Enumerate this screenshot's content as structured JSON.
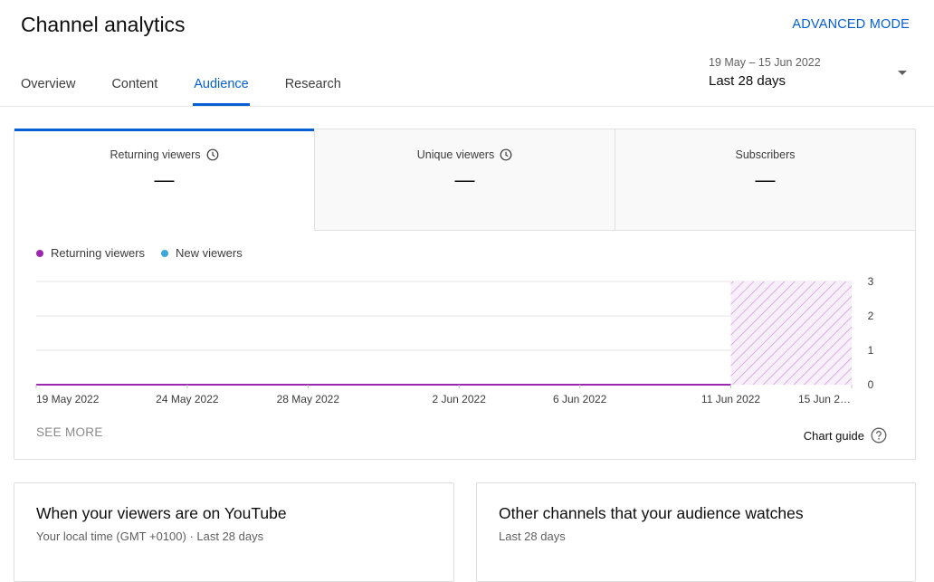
{
  "header": {
    "title": "Channel analytics",
    "advanced_mode": "ADVANCED MODE"
  },
  "tabs": [
    {
      "label": "Overview"
    },
    {
      "label": "Content"
    },
    {
      "label": "Audience",
      "active": true
    },
    {
      "label": "Research"
    }
  ],
  "date_picker": {
    "range": "19 May – 15 Jun 2022",
    "label": "Last 28 days"
  },
  "metrics": [
    {
      "label": "Returning viewers",
      "value": "—",
      "icon": "clock-icon"
    },
    {
      "label": "Unique viewers",
      "value": "—",
      "icon": "clock-icon"
    },
    {
      "label": "Subscribers",
      "value": "—"
    }
  ],
  "chart_data": {
    "type": "line",
    "legend_position": "top-left",
    "series": [
      {
        "name": "Returning viewers",
        "color": "#9c27b0",
        "values": [
          0,
          0,
          0,
          0,
          0,
          0,
          0,
          0,
          0,
          0,
          0,
          0,
          0,
          0,
          0,
          0,
          0,
          0,
          0,
          0,
          0,
          0,
          0,
          0
        ]
      },
      {
        "name": "New viewers",
        "color": "#3ea6d8"
      }
    ],
    "x_ticks": [
      {
        "label": "19 May 2022",
        "index": 0
      },
      {
        "label": "24 May 2022",
        "index": 5
      },
      {
        "label": "28 May 2022",
        "index": 9
      },
      {
        "label": "2 Jun 2022",
        "index": 14
      },
      {
        "label": "6 Jun 2022",
        "index": 18
      },
      {
        "label": "11 Jun 2022",
        "index": 23
      },
      {
        "label": "15 Jun 2…",
        "index": 27
      }
    ],
    "x_range": [
      0,
      27
    ],
    "ylim": [
      0,
      3
    ],
    "y_ticks": [
      0,
      1,
      2,
      3
    ],
    "incomplete_data_range": {
      "from": "11 Jun 2022",
      "to": "15 Jun 2022",
      "start_index": 23
    },
    "grid": true,
    "hatch_color": "#ce93d8",
    "grid_color": "#e5e5e5"
  },
  "see_more": "SEE MORE",
  "chart_guide": "Chart guide",
  "cards": [
    {
      "title": "When your viewers are on YouTube",
      "subtitle": "Your local time (GMT +0100) · Last 28 days"
    },
    {
      "title": "Other channels that your audience watches",
      "subtitle": "Last 28 days"
    }
  ],
  "colors": {
    "accent": "#065fd4"
  }
}
